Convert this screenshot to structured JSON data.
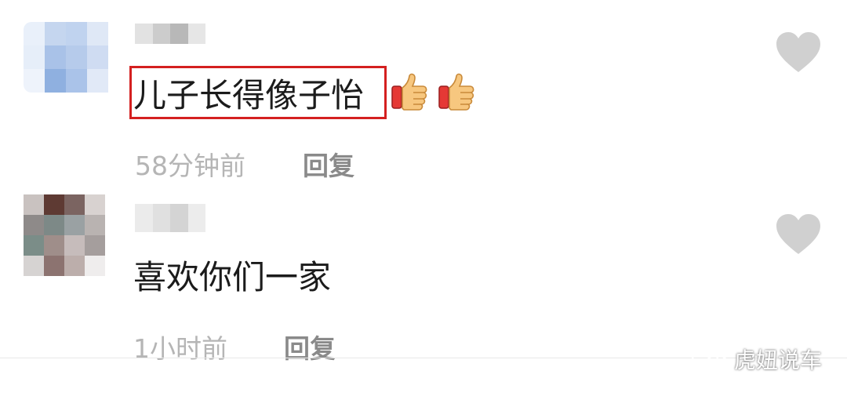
{
  "comments": [
    {
      "text": "儿子长得像子怡",
      "emojis": [
        "thumbs-up-icon",
        "thumbs-up-icon"
      ],
      "time": "58分钟前",
      "reply_label": "回复"
    },
    {
      "text": "喜欢你们一家",
      "time": "1小时前",
      "reply_label": "回复"
    }
  ],
  "watermark": {
    "text": "虎妞说车"
  },
  "colors": {
    "highlight_border": "#d42020",
    "comment_text": "#1b1b1b",
    "meta_text": "#b5b5b5",
    "reply_text": "#8a8a8a",
    "like_icon": "#d0d0d0"
  },
  "icons": {
    "like": "heart-icon",
    "watermark_logo": "wechat-logo-icon"
  }
}
